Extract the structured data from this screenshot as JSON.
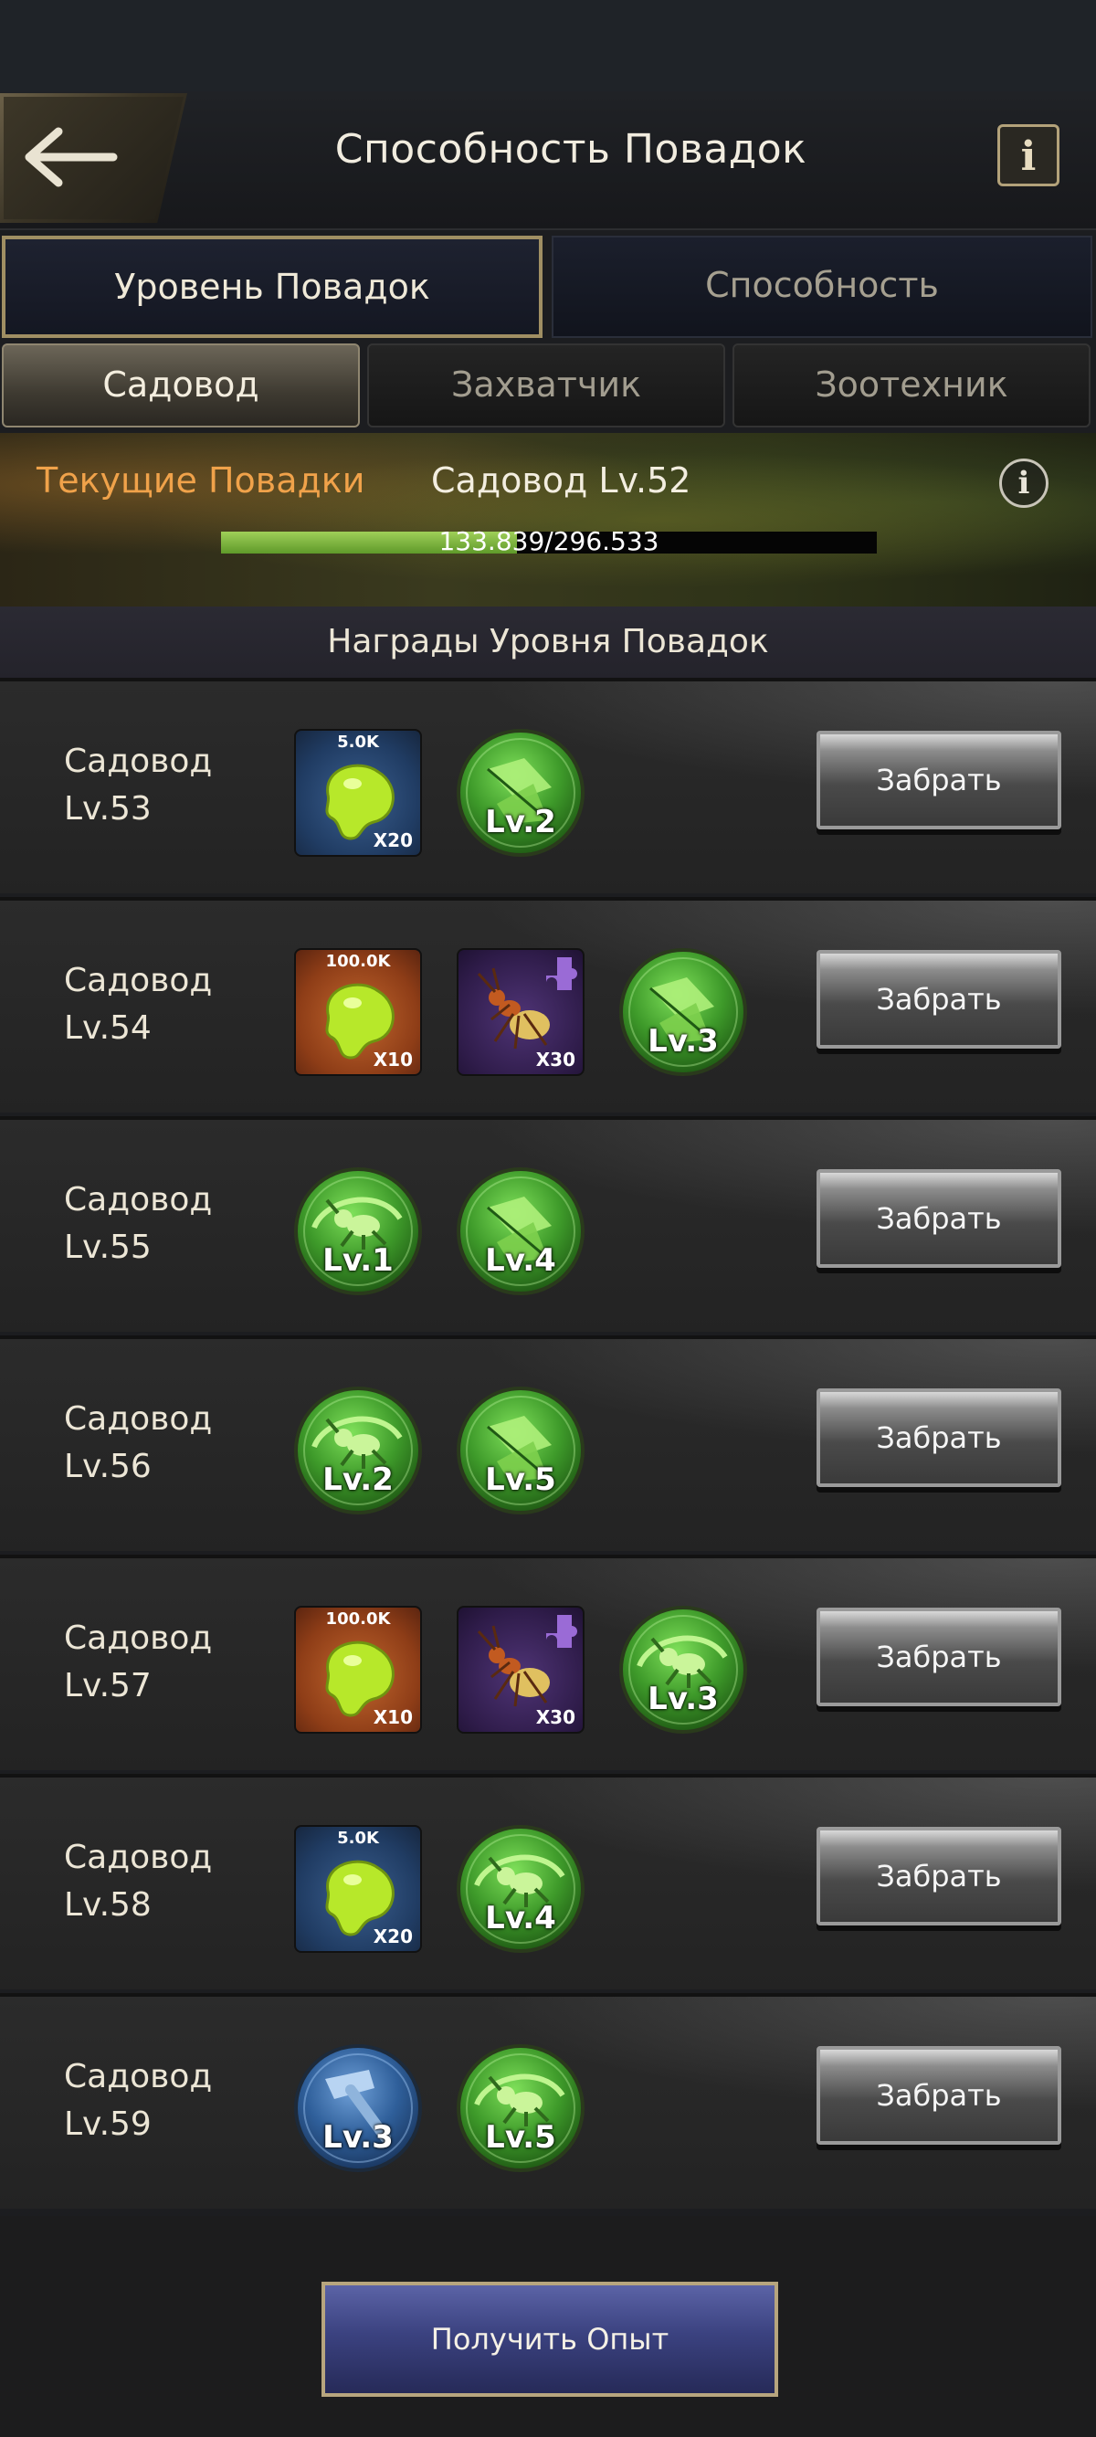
{
  "header": {
    "title": "Способность Повадок",
    "info_label": "i"
  },
  "main_tabs": [
    {
      "label": "Уровень Повадок",
      "active": true
    },
    {
      "label": "Способность",
      "active": false
    }
  ],
  "sub_tabs": [
    {
      "label": "Садовод",
      "active": true
    },
    {
      "label": "Захватчик",
      "active": false
    },
    {
      "label": "Зоотехник",
      "active": false
    }
  ],
  "current": {
    "label": "Текущие Повадки",
    "level_text": "Садовод Lv.52",
    "progress_text": "133.839/296.533",
    "progress_fraction": 0.4514,
    "info_label": "i"
  },
  "rewards_header": "Награды Уровня Повадок",
  "claim_label": "Забрать",
  "rows": [
    {
      "name": "Садовод",
      "level": "Lv.53",
      "rewards": [
        {
          "kind": "square",
          "icon": "slime-icon",
          "bg": "blue",
          "top": "5.0K",
          "bottom": "X20"
        },
        {
          "kind": "round",
          "icon": "leaf-skill-icon",
          "level": "Lv.2"
        }
      ]
    },
    {
      "name": "Садовод",
      "level": "Lv.54",
      "rewards": [
        {
          "kind": "square",
          "icon": "slime-icon",
          "bg": "orange",
          "top": "100.0K",
          "bottom": "X10"
        },
        {
          "kind": "square",
          "icon": "ant-puzzle-icon",
          "bg": "purple",
          "top": "",
          "bottom": "X30"
        },
        {
          "kind": "round",
          "icon": "leaf-skill-icon",
          "level": "Lv.3"
        }
      ]
    },
    {
      "name": "Садовод",
      "level": "Lv.55",
      "rewards": [
        {
          "kind": "round",
          "icon": "ant-skill-icon",
          "level": "Lv.1"
        },
        {
          "kind": "round",
          "icon": "leaf-skill-icon",
          "level": "Lv.4"
        }
      ]
    },
    {
      "name": "Садовод",
      "level": "Lv.56",
      "rewards": [
        {
          "kind": "round",
          "icon": "ant-skill-icon",
          "level": "Lv.2"
        },
        {
          "kind": "round",
          "icon": "leaf-skill-icon",
          "level": "Lv.5"
        }
      ]
    },
    {
      "name": "Садовод",
      "level": "Lv.57",
      "rewards": [
        {
          "kind": "square",
          "icon": "slime-icon",
          "bg": "orange",
          "top": "100.0K",
          "bottom": "X10"
        },
        {
          "kind": "square",
          "icon": "ant-puzzle-icon",
          "bg": "purple",
          "top": "",
          "bottom": "X30"
        },
        {
          "kind": "round",
          "icon": "ant-skill-icon",
          "level": "Lv.3"
        }
      ]
    },
    {
      "name": "Садовод",
      "level": "Lv.58",
      "rewards": [
        {
          "kind": "square",
          "icon": "slime-icon",
          "bg": "blue",
          "top": "5.0K",
          "bottom": "X20"
        },
        {
          "kind": "round",
          "icon": "ant-skill-icon",
          "level": "Lv.4"
        }
      ]
    },
    {
      "name": "Садовод",
      "level": "Lv.59",
      "rewards": [
        {
          "kind": "round",
          "icon": "hammer-skill-icon",
          "level": "Lv.3",
          "tint": "blue"
        },
        {
          "kind": "round",
          "icon": "ant-skill-icon",
          "level": "Lv.5"
        }
      ]
    }
  ],
  "footer": {
    "button_label": "Получить Опыт"
  }
}
